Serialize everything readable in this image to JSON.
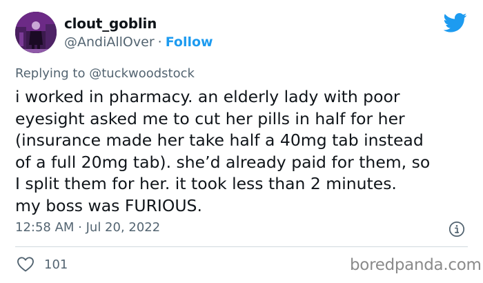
{
  "colors": {
    "link": "#1d9bf0",
    "muted": "#536471",
    "text": "#0f1419",
    "twitter_blue": "#1d9bf0",
    "divider": "#cfd9de"
  },
  "author": {
    "display_name": "clout_goblin",
    "handle": "@AndiAllOver",
    "separator": "·",
    "follow_label": "Follow",
    "avatar_icon": "avatar-photo"
  },
  "brand": {
    "icon": "twitter-bird-icon"
  },
  "tweet": {
    "reply_text": "Replying to @tuckwoodstock",
    "lines": [
      "i worked in pharmacy. an elderly lady with poor",
      "eyesight asked me to cut her pills in half for her",
      "(insurance made her take half a 40mg tab instead",
      "of a full 20mg tab). she’d already paid for them, so",
      "I split them for her. it took less than 2 minutes.",
      "my boss was FURIOUS."
    ],
    "timestamp": "12:58 AM · Jul 20, 2022"
  },
  "actions": {
    "like_icon": "heart-icon",
    "like_count": "101",
    "info_icon": "info-icon"
  },
  "watermark": "boredpanda.com"
}
